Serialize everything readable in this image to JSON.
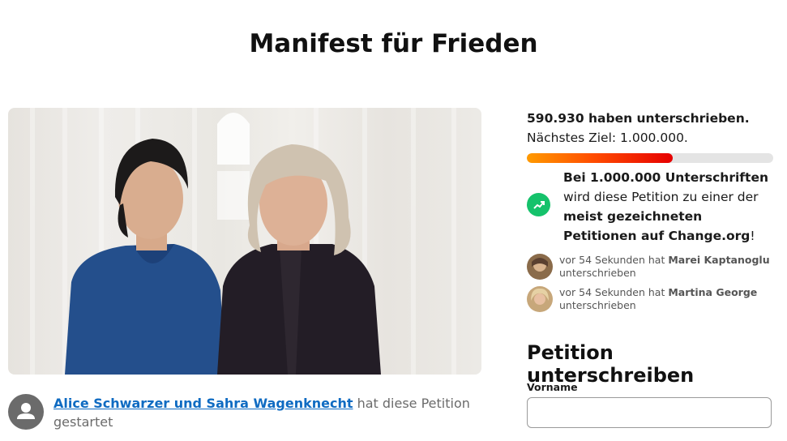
{
  "page": {
    "title": "Manifest für Frieden"
  },
  "starter": {
    "names": "Alice Schwarzer und Sahra Wagenknecht",
    "suffix": " hat diese Petition gestartet"
  },
  "progress": {
    "count_text": "590.930 haben unterschrieben.",
    "goal_text": "Nächstes Ziel: 1.000.000.",
    "fraction": 0.59093,
    "colors": {
      "start": "#ff9a00",
      "end": "#e60000",
      "track": "#e4e4e4"
    }
  },
  "milestone": {
    "icon": "trending-up-icon",
    "part1": "Bei 1.000.000 Unterschriften",
    "part2": "wird diese Petition zu einer der",
    "part3": "meist gezeichneten Petitionen auf Change.org",
    "part4": "!",
    "color": "#15c26b"
  },
  "recent_signers": [
    {
      "time": "vor 54 Sekunden hat ",
      "name": "Marei Kaptanoglu",
      "action": "unterschrieben"
    },
    {
      "time": "vor 54 Sekunden hat ",
      "name": "Martina George",
      "action": "unterschrieben"
    }
  ],
  "form": {
    "heading": "Petition unterschreiben",
    "first_name_label": "Vorname",
    "first_name_value": ""
  }
}
